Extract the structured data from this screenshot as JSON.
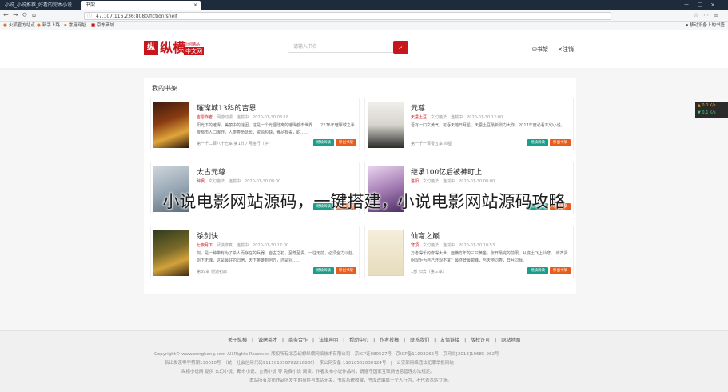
{
  "browser": {
    "tabs": [
      {
        "label": "小说_小说推荐_好看的完本小说"
      },
      {
        "label": "书架"
      }
    ],
    "url": "47.107.116.236:8080/fiction/shelf",
    "bookmarks": [
      "火狐官方站点",
      "新手上路",
      "常用网址",
      "京东商城"
    ],
    "mobile_bookmarks": "移动设备上的书签"
  },
  "header": {
    "logo_mark": "纵",
    "logo_name": "纵横",
    "logo_sub1": "原创精品",
    "logo_sub2": "中文网",
    "search_placeholder": "请输入书名",
    "search_icon": "search-icon",
    "shelf_link": "书架",
    "logout_link": "注销"
  },
  "shelf": {
    "title": "我的书架",
    "books": [
      {
        "title": "璀璨城13科的吉恩",
        "author": "吉恩作者",
        "category": "网游动漫",
        "status": "连载中",
        "update": "2020-01-30 08:18",
        "desc": "阳光下的璀璨，美丽中的谜团，这是一个光怪陆离的璀璨都市世界……2276年璀璨城之半夜都市人口爆炸，人类寿命延长，资源短缺，食品有毒，职……",
        "chapter": "第一千二百八十七章 第1节 / 网络行（中）"
      },
      {
        "title": "元尊",
        "author": "天蚕土豆",
        "category": "玄幻魔法",
        "status": "连载中",
        "update": "2020-01-30 12:00",
        "desc": "吾有一口玄黄气，可吞天地日月星。天蚕土豆最新鼎力大作，2017年度必看玄幻小说。",
        "chapter": "第一千一百零五章 炎星"
      },
      {
        "title": "太古元尊",
        "author": "醉枫",
        "category": "玄幻魔法",
        "status": "连载中",
        "update": "2020-01-30 08:00",
        "desc": "",
        "chapter": ""
      },
      {
        "title": "继承100亿后被神盯上",
        "author": "进阳",
        "category": "玄幻魔法",
        "status": "连载中",
        "update": "2020-01-30 08:00",
        "desc": "",
        "chapter": ""
      },
      {
        "title": "杀剑诀",
        "author": "七夜月下",
        "category": "武侠修真",
        "status": "连载中",
        "update": "2020-01-30 17:00",
        "desc": "剑，是一种带有为了杀人而存在的兵器，自古之初，至尊至贵，一往无前，必须全力以赴。剑下无魂，这是最好的归宿，天下英雄到何方，还是对……",
        "chapter": "第39章 剑道初启"
      },
      {
        "title": "仙穹之巅",
        "author": "穹顶",
        "category": "玄幻魔法",
        "status": "连载中",
        "update": "2020-01-30 10:53",
        "desc": "万者得乐的修得大世，面横方年的三只黄金，张开最完的前限。从底土飞上仙穹。 谁齐贤明规矩为自己坏规不掌？最终登最巅峰，与天地同寿，日月同辉。",
        "chapter": "1部 归去（第三章）"
      }
    ],
    "read_label": "继续阅读",
    "remove_label": "移出书架"
  },
  "footer": {
    "links": "关于纵横　|　诚聘英才　|　商务合作　|　法律声明　|　帮助中心　|　作者投稿　|　联系我们　|　友情链接　|　版权许可　|　网站地图",
    "line1": "Copyright© www.zongheng.com All Rights Reserved 版权所有北京幻想纵横网络技术有限公司　京ICP证080527号　京ICP备11008265号　京网文[2018]10685-962号",
    "line2": "新出发京零字第朝130010号　（统一社会信用代码91110105678221683F）　京公网安备 11010502030124号　|　公安部网络违法犯罪举报网站",
    "line3": "纵横小说网 提供 玄幻小说、都市小说、言情小说 等 免费小说 阅读。作者发布小说作品时，请遵守国家互联网信息管理办法规定。",
    "line4": "本站所有发布作品所发生的事件与本站无关，书库系统收藏，书库改编属于个人行为，不代表本站立场。"
  },
  "overlay_text": "小说电影网站源码，一键搭建，小说电影网站源码攻略",
  "side_widget": {
    "up": "▲ 0.0 K/s",
    "down": "▼ 0.1 K/s"
  }
}
